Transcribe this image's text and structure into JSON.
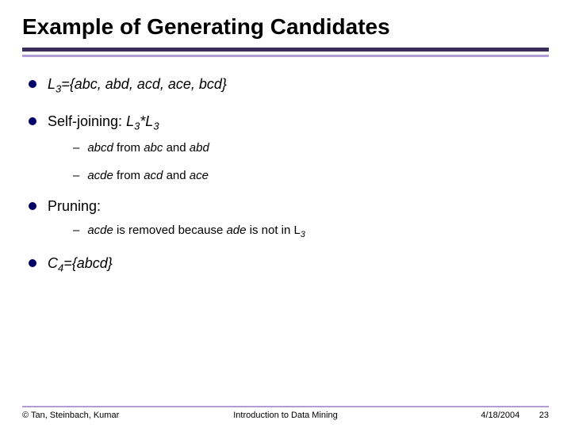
{
  "title": "Example of Generating Candidates",
  "bullets": {
    "b1_prefix": "L",
    "b1_sub": "3",
    "b1_rest": "={abc, abd, acd, ace, bcd}",
    "b2_prefix": "Self-joining: ",
    "b2_L": "L",
    "b2_sub": "3",
    "b2_star": "*L",
    "b2_sub2": "3",
    "s1_em": "abcd",
    "s1_rest": "  from ",
    "s1_em2": "abc",
    "s1_and": " and ",
    "s1_em3": "abd",
    "s2_em": "acde",
    "s2_rest": "  from ",
    "s2_em2": "acd",
    "s2_and": " and ",
    "s2_em3": "ace",
    "b3": "Pruning:",
    "s3_em": "acde",
    "s3_mid": " is removed because ",
    "s3_em2": "ade",
    "s3_rest": " is not in L",
    "s3_sub": "3",
    "b4_prefix": "C",
    "b4_sub": "4",
    "b4_rest": "={abcd}"
  },
  "footer": {
    "left": "© Tan, Steinbach, Kumar",
    "center": "Introduction to Data Mining",
    "date": "4/18/2004",
    "page": "23"
  }
}
